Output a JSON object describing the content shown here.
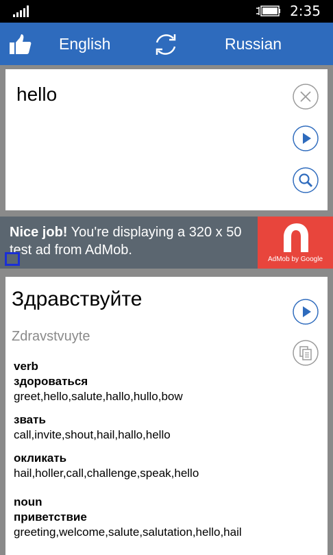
{
  "status_bar": {
    "time": "2:35"
  },
  "header": {
    "source_language": "English",
    "target_language": "Russian"
  },
  "input": {
    "text": "hello"
  },
  "ad": {
    "headline": "Nice job!",
    "body": " You're displaying a 320 x 50 test ad from AdMob.",
    "brand": "AdMob by Google"
  },
  "result": {
    "translation": "Здравствуйте",
    "transliteration": "Zdravstvuyte",
    "groups": [
      {
        "pos": "verb",
        "entries": [
          {
            "word": "здороваться",
            "synonyms": "greet,hello,salute,hallo,hullo,bow"
          },
          {
            "word": "звать",
            "synonyms": "call,invite,shout,hail,hallo,hello"
          },
          {
            "word": "окликать",
            "synonyms": "hail,holler,call,challenge,speak,hello"
          }
        ]
      },
      {
        "pos": "noun",
        "entries": [
          {
            "word": "приветствие",
            "synonyms": "greeting,welcome,salute,salutation,hello,hail"
          }
        ]
      }
    ]
  },
  "colors": {
    "header": "#2e6bbd",
    "accent_button": "#2e6bbd",
    "ad_background": "#5b6670",
    "ad_logo": "#e8453c",
    "page_background": "#8a8a8a"
  }
}
